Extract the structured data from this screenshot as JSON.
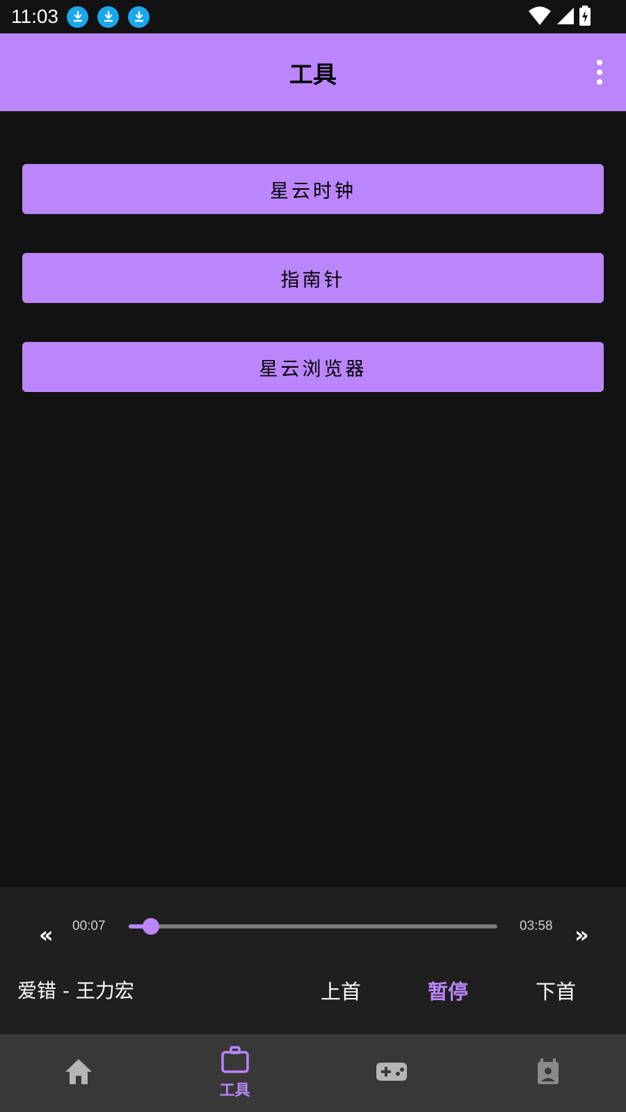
{
  "status_bar": {
    "time": "11:03",
    "notification_icons": [
      "download-icon",
      "download-icon",
      "download-icon"
    ],
    "notification_color": "#1aa7ec",
    "right_icons": [
      "wifi-icon",
      "cell-signal-icon",
      "battery-charging-icon"
    ]
  },
  "app_bar": {
    "title": "工具",
    "background": "#bb86fc",
    "menu_icon": "more-vert-icon"
  },
  "tools": [
    {
      "label": "星云时钟"
    },
    {
      "label": "指南针"
    },
    {
      "label": "星云浏览器"
    }
  ],
  "player": {
    "prev_label": "«",
    "next_label": "»",
    "current_time": "00:07",
    "total_time": "03:58",
    "progress": 0.06,
    "song": "爱错 - 王力宏",
    "controls": {
      "previous": "上首",
      "pause": "暂停",
      "next": "下首"
    }
  },
  "bottom_nav": {
    "items": [
      {
        "icon": "home-icon",
        "label": "",
        "active": false
      },
      {
        "icon": "briefcase-icon",
        "label": "工具",
        "active": true
      },
      {
        "icon": "gamepad-icon",
        "label": "",
        "active": false
      },
      {
        "icon": "contact-calendar-icon",
        "label": "",
        "active": false
      }
    ],
    "active_color": "#bb86fc"
  }
}
